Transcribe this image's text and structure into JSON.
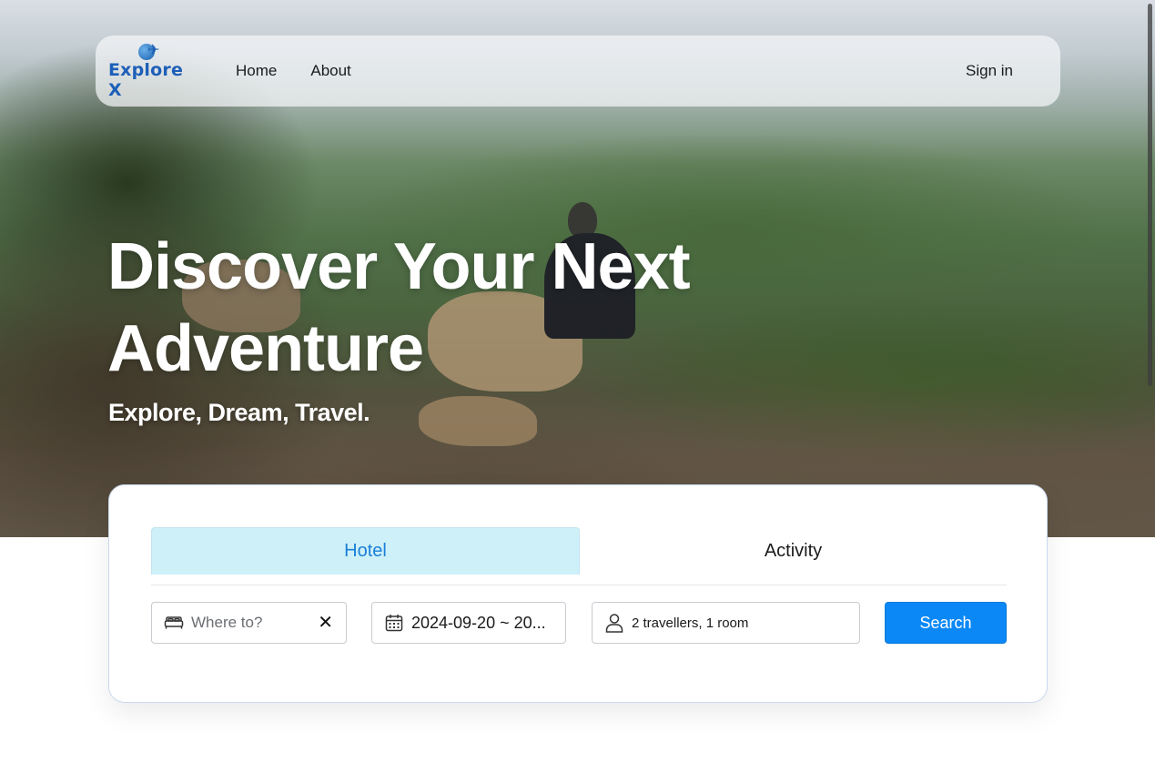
{
  "brand": {
    "name": "Explore X"
  },
  "nav": {
    "links": [
      "Home",
      "About"
    ],
    "sign_in": "Sign in"
  },
  "hero": {
    "title": "Discover Your Next Adventure",
    "subtitle": "Explore, Dream, Travel."
  },
  "search": {
    "tabs": [
      {
        "label": "Hotel",
        "active": true
      },
      {
        "label": "Activity",
        "active": false
      }
    ],
    "destination": {
      "placeholder": "Where to?",
      "value": ""
    },
    "dates": {
      "value": "2024-09-20 ~ 2024-09-21",
      "display": "2024-09-20 ~ 20..."
    },
    "guests": {
      "value": "2 travellers, 1 room"
    },
    "button_label": "Search"
  },
  "colors": {
    "accent": "#0b88f6",
    "active_tab_bg": "#cef1f9",
    "active_tab_text": "#1a7fd6",
    "brand": "#1d5fb8"
  },
  "icons": {
    "bed": "bed-icon",
    "clear": "close-icon",
    "calendar": "calendar-icon",
    "user": "user-icon",
    "logo": "globe-plane-icon"
  }
}
